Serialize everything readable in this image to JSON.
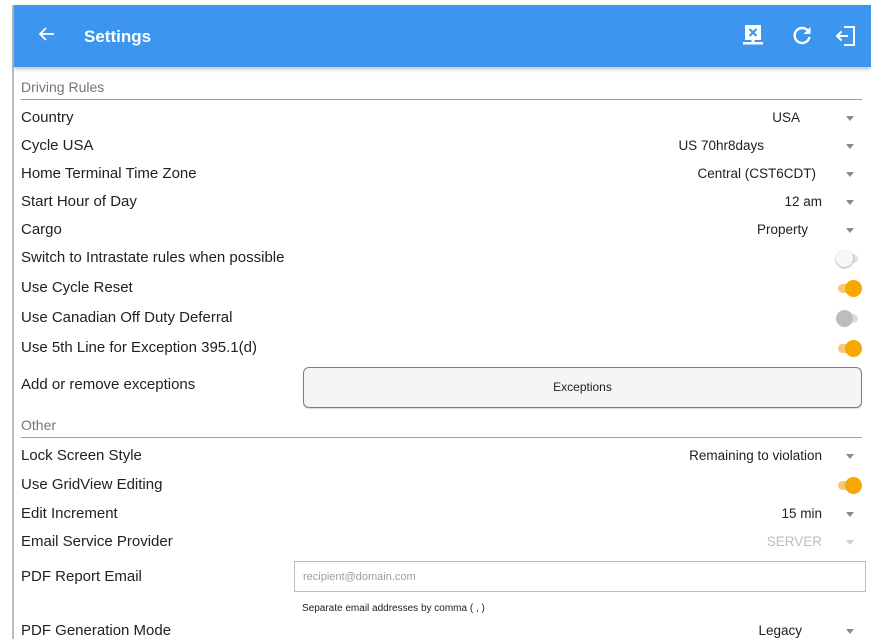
{
  "appbar": {
    "title": "Settings"
  },
  "sections": {
    "driving_rules": "Driving Rules",
    "other": "Other"
  },
  "rows": {
    "country": {
      "label": "Country",
      "value": "USA"
    },
    "cycle": {
      "label": "Cycle USA",
      "value": "US 70hr8days"
    },
    "timezone": {
      "label": "Home Terminal Time Zone",
      "value": "Central (CST6CDT)"
    },
    "start_hour": {
      "label": "Start Hour of Day",
      "value": "12 am"
    },
    "cargo": {
      "label": "Cargo",
      "value": "Property"
    },
    "intrastate": {
      "label": "Switch to Intrastate rules when possible",
      "on": false
    },
    "cycle_reset": {
      "label": "Use Cycle Reset",
      "on": true
    },
    "canadian_deferral": {
      "label": "Use Canadian Off Duty Deferral",
      "on": false
    },
    "fifth_line": {
      "label": "Use 5th Line for Exception 395.1(d)",
      "on": true
    },
    "exceptions": {
      "label": "Add or remove exceptions",
      "button": "Exceptions"
    },
    "lock_screen": {
      "label": "Lock Screen Style",
      "value": "Remaining to violation"
    },
    "gridview": {
      "label": "Use GridView Editing",
      "on": true
    },
    "edit_increment": {
      "label": "Edit Increment",
      "value": "15 min"
    },
    "email_provider": {
      "label": "Email Service Provider",
      "value": "SERVER"
    },
    "pdf_email": {
      "label": "PDF Report Email",
      "placeholder": "recipient@domain.com",
      "helper": "Separate email addresses by comma ( , )"
    },
    "pdf_mode": {
      "label": "PDF Generation Mode",
      "value": "Legacy"
    }
  },
  "colors": {
    "appbar": "#3c95ee",
    "accent": "#f7a800"
  },
  "icons": [
    "back-arrow-icon",
    "close-document-icon",
    "refresh-icon",
    "logout-icon",
    "dropdown-caret-icon"
  ]
}
